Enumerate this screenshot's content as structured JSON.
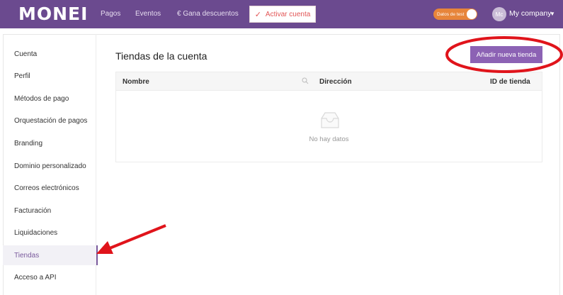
{
  "header": {
    "logo": "MONEI",
    "nav": [
      "Pagos",
      "Eventos",
      "€ Gana descuentos"
    ],
    "activate_label": "Activar cuenta",
    "test_toggle_label": "Datos de test",
    "avatar_initials": "Mc",
    "company": "My company"
  },
  "sidebar": {
    "items": [
      {
        "label": "Cuenta"
      },
      {
        "label": "Perfil"
      },
      {
        "label": "Métodos de pago"
      },
      {
        "label": "Orquestación de pagos"
      },
      {
        "label": "Branding"
      },
      {
        "label": "Dominio personalizado"
      },
      {
        "label": "Correos electrónicos"
      },
      {
        "label": "Facturación"
      },
      {
        "label": "Liquidaciones"
      },
      {
        "label": "Tiendas"
      },
      {
        "label": "Acceso a API"
      }
    ],
    "active": "Tiendas"
  },
  "main": {
    "title": "Tiendas de la cuenta",
    "add_button": "Añadir nueva tienda",
    "table": {
      "columns": [
        "Nombre",
        "Dirección",
        "ID de tienda"
      ],
      "empty_text": "No hay datos"
    }
  },
  "colors": {
    "brand": "#6b4a8f",
    "accent": "#8c62b4",
    "annotation": "#e0141b",
    "test_toggle": "#e7853a"
  }
}
